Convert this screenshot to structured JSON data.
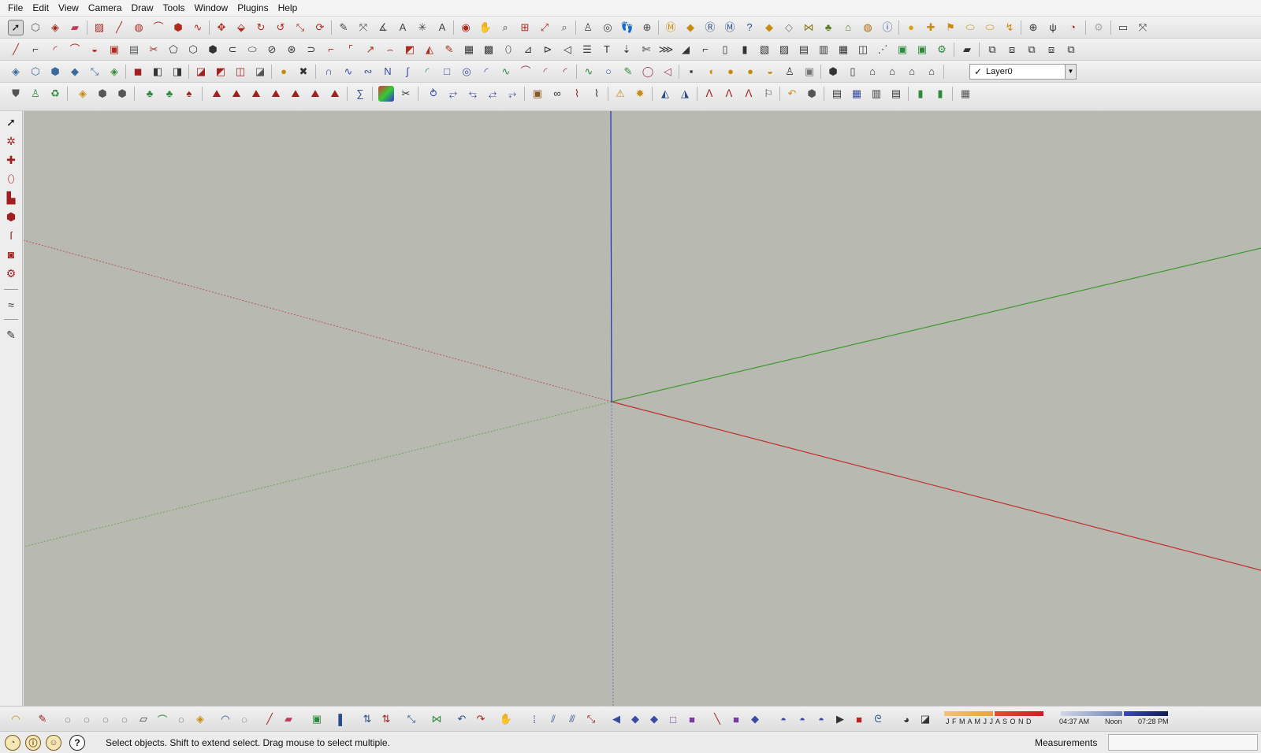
{
  "menu": [
    "File",
    "Edit",
    "View",
    "Camera",
    "Draw",
    "Tools",
    "Window",
    "Plugins",
    "Help"
  ],
  "layer": {
    "name": "Layer0",
    "check": "✓"
  },
  "status": {
    "message": "Select objects. Shift to extend select. Drag mouse to select multiple."
  },
  "measurements": {
    "label": "Measurements",
    "value": ""
  },
  "shadow": {
    "months": "J F M A M J J A S O N D",
    "time_start": "04:37 AM",
    "noon": "Noon",
    "time_end": "07:28 PM"
  },
  "axis_colors": {
    "red": "#c0302c",
    "green": "#3f9a2e",
    "blue": "#1f2fbf"
  }
}
